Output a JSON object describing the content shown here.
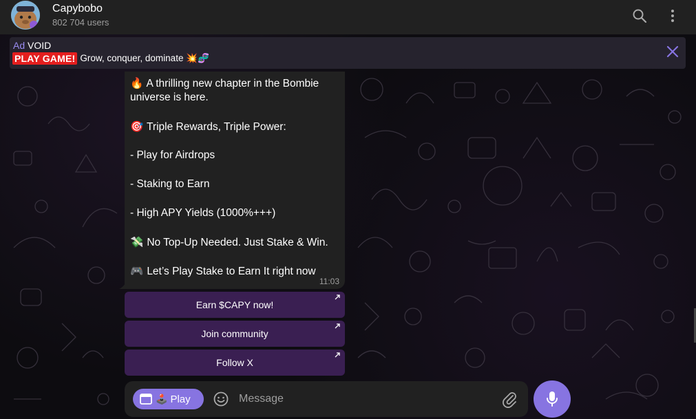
{
  "header": {
    "title": "Capybobo",
    "subtitle": "802 704 users",
    "search_icon": "search-icon",
    "menu_icon": "more-vertical-icon"
  },
  "ad": {
    "tag": "Ad",
    "name": "VOID",
    "badge": "PLAY GAME!",
    "text": "Grow, conquer, dominate 💥🧬"
  },
  "message": {
    "lines": [
      {
        "emoji": "🔥",
        "text": "A thrilling new chapter in the Bombie"
      },
      {
        "emoji": "",
        "text": "universe is here."
      },
      {
        "emoji": "🎯",
        "text": "Triple Rewards, Triple Power:"
      },
      {
        "emoji": "",
        "text": "- Play for Airdrops"
      },
      {
        "emoji": "",
        "text": "- Staking to Earn"
      },
      {
        "emoji": "",
        "text": "- High APY Yields (1000%+++)"
      },
      {
        "emoji": "💸",
        "text": "No Top-Up Needed. Just Stake & Win."
      },
      {
        "emoji": "🎮",
        "text": "Let’s Play Stake to Earn It right now"
      }
    ],
    "time": "11:03"
  },
  "buttons": [
    {
      "label": "Earn $CAPY now!"
    },
    {
      "label": "Join community"
    },
    {
      "label": "Follow X"
    }
  ],
  "composer": {
    "play_label": "Play",
    "play_emoji": "🕹️",
    "placeholder": "Message"
  },
  "colors": {
    "accent": "#8774e1",
    "ad_badge": "#e41e1e",
    "inline_button": "#3a1f52",
    "bubble": "#212121",
    "header": "#212121"
  }
}
